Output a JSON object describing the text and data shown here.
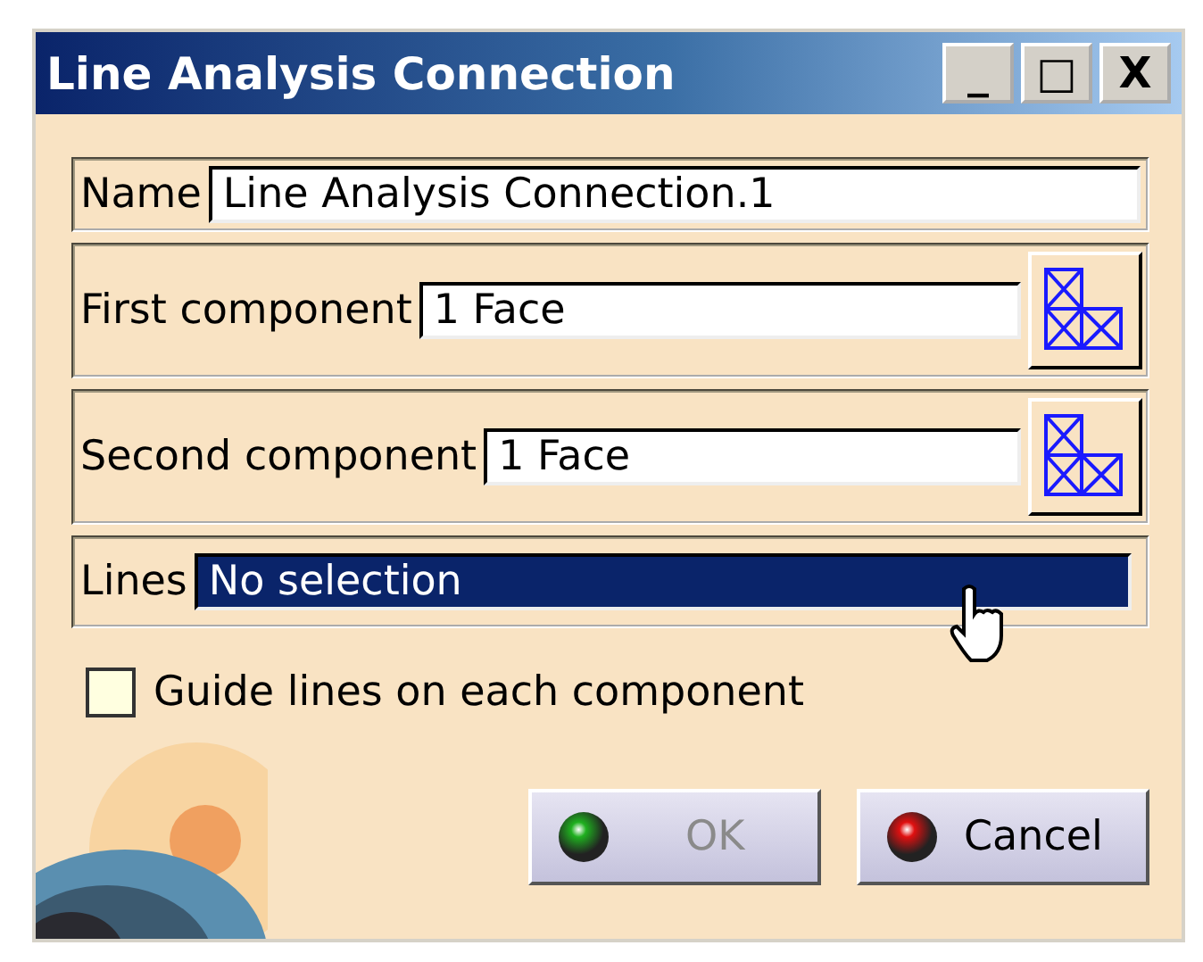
{
  "window": {
    "title": "Line Analysis Connection",
    "controls": [
      "_",
      "□",
      "X"
    ]
  },
  "name_field": {
    "label": "Name",
    "value": "Line Analysis Connection.1"
  },
  "components": [
    {
      "label": "First component",
      "value": "1 Face"
    },
    {
      "label": "Second component",
      "value": "1 Face"
    }
  ],
  "lines_field": {
    "label": "Lines",
    "value": "No selection",
    "selected": true
  },
  "guide_lines": {
    "label": "Guide lines on each component",
    "checked": false
  },
  "buttons": [
    {
      "label": "OK",
      "kind": "ok",
      "disabled": true
    },
    {
      "label": "Cancel",
      "kind": "cancel",
      "disabled": false
    }
  ]
}
